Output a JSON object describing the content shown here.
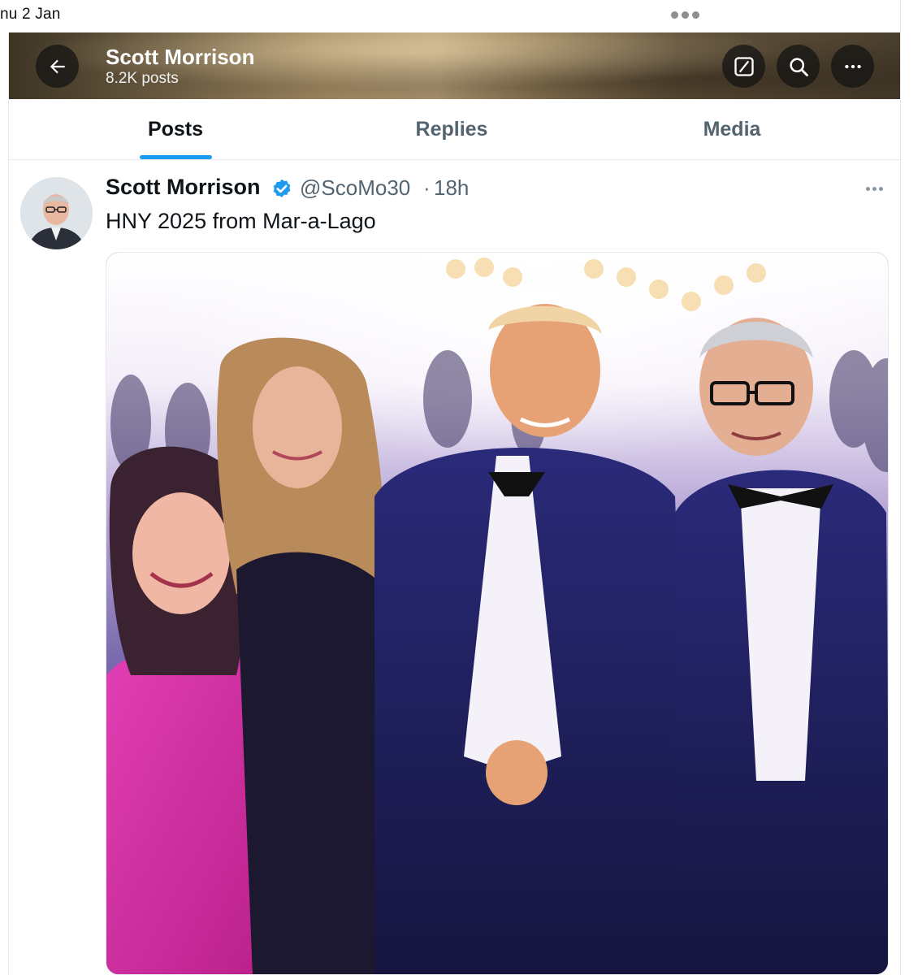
{
  "status_bar": {
    "time_partial": "nu 2 Jan"
  },
  "header": {
    "name": "Scott Morrison",
    "posts_count": "8.2K posts"
  },
  "tabs": [
    {
      "label": "Posts",
      "active": true
    },
    {
      "label": "Replies",
      "active": false
    },
    {
      "label": "Media",
      "active": false
    }
  ],
  "tweet": {
    "author_name": "Scott Morrison",
    "verified": true,
    "handle": "@ScoMo30",
    "separator": "·",
    "time": "18h",
    "text": "HNY 2025 from Mar-a-Lago",
    "media": "photo"
  },
  "icons": {
    "back": "arrow-left-icon",
    "grok": "grok-icon",
    "search": "search-icon",
    "more": "more-horizontal-icon",
    "verified": "verified-badge-icon"
  },
  "colors": {
    "accent": "#1d9bf0",
    "text_primary": "#0f1419",
    "text_secondary": "#536471"
  }
}
